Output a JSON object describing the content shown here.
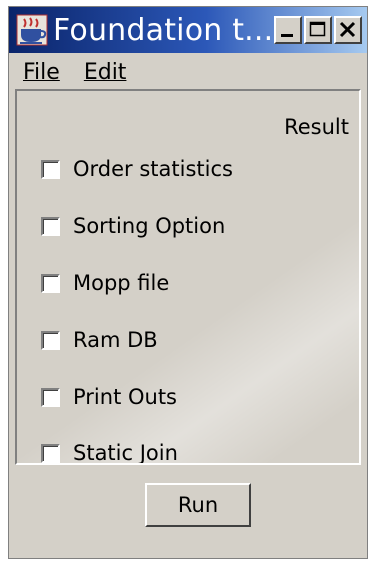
{
  "window": {
    "title": "Foundation t...",
    "app_icon": "java-coffee-cup-icon",
    "controls": [
      "minimize-icon",
      "maximize-icon",
      "close-icon"
    ]
  },
  "menu": {
    "items": [
      {
        "label": "File"
      },
      {
        "label": "Edit"
      }
    ]
  },
  "panel": {
    "column_header": "Result",
    "options": [
      {
        "label": "Order statistics",
        "checked": false
      },
      {
        "label": "Sorting Option",
        "checked": false
      },
      {
        "label": "Mopp file",
        "checked": false
      },
      {
        "label": "Ram DB",
        "checked": false
      },
      {
        "label": "Print Outs",
        "checked": false
      },
      {
        "label": "Static Join",
        "checked": false
      }
    ]
  },
  "actions": {
    "run_label": "Run"
  },
  "colors": {
    "title_bar_start": "#0a246a",
    "title_bar_end": "#a6caf0",
    "window_bg": "#d4d0c8"
  }
}
